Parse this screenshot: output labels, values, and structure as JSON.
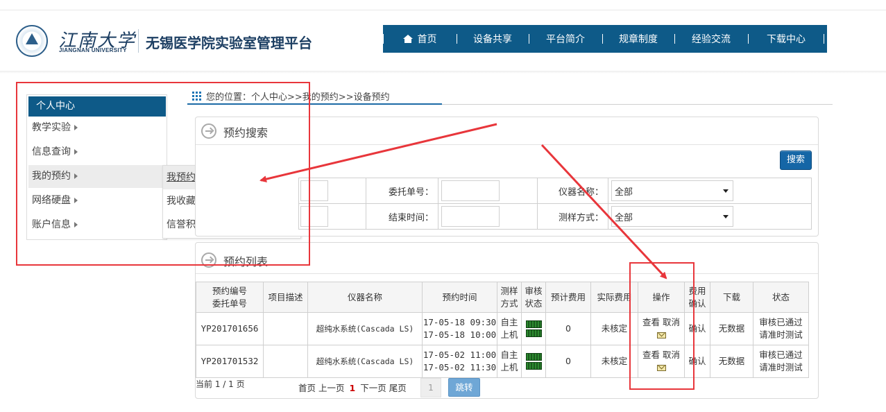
{
  "header": {
    "logo_cn": "江南大学",
    "logo_en": "JIANGNAN UNIVERSITY",
    "platform_title": "无锡医学院实验室管理平台",
    "nav": [
      {
        "label": "首页",
        "icon": "home-icon"
      },
      {
        "label": "设备共享"
      },
      {
        "label": "平台简介"
      },
      {
        "label": "规章制度"
      },
      {
        "label": "经验交流"
      },
      {
        "label": "下载中心"
      }
    ]
  },
  "sidebar": {
    "title": "个人中心",
    "items": [
      {
        "label": "教学实验"
      },
      {
        "label": "信息查询"
      },
      {
        "label": "我的预约"
      },
      {
        "label": "网络硬盘"
      },
      {
        "label": "账户信息"
      }
    ],
    "submenu": [
      {
        "label": "我预约的设备"
      },
      {
        "label": "我收藏的设备"
      },
      {
        "label": "信誉积分"
      }
    ]
  },
  "breadcrumb": "您的位置：个人中心>>我的预约>>设备预约",
  "search_panel": {
    "title": "预约搜索",
    "search_button": "搜索",
    "labels": {
      "delegation_no": "委托单号：",
      "instrument_name": "仪器名称：",
      "end_time": "结束时间：",
      "sample_method": "测样方式："
    },
    "instrument_select": "全部",
    "sample_select": "全部"
  },
  "list_panel": {
    "title": "预约列表",
    "columns": {
      "no_a": "预约编号",
      "no_b": "委托单号",
      "desc": "项目描述",
      "instrument": "仪器名称",
      "time": "预约时间",
      "method_a": "测样",
      "method_b": "方式",
      "audit_a": "审核",
      "audit_b": "状态",
      "est_fee": "预计费用",
      "actual_fee": "实际费用",
      "ops": "操作",
      "fee_confirm_a": "费用",
      "fee_confirm_b": "确认",
      "download": "下载",
      "status": "状态"
    },
    "rows": [
      {
        "no": "YP201701656",
        "desc": "",
        "instrument": "超纯水系统(Cascada LS)",
        "time_start": "17-05-18 09:30",
        "time_end": "17-05-18 10:00",
        "method_a": "自主",
        "method_b": "上机",
        "est_fee": "0",
        "actual_fee": "未核定",
        "view": "查看",
        "cancel": "取消",
        "confirm": "确认",
        "download": "无数据",
        "status_a": "审核已通过",
        "status_b": "请准时测试"
      },
      {
        "no": "YP201701532",
        "desc": "",
        "instrument": "超纯水系统(Cascada LS)",
        "time_start": "17-05-02 11:00",
        "time_end": "17-05-02 11:30",
        "method_a": "自主",
        "method_b": "上机",
        "est_fee": "0",
        "actual_fee": "未核定",
        "view": "查看",
        "cancel": "取消",
        "confirm": "确认",
        "download": "无数据",
        "status_a": "审核已通过",
        "status_b": "请准时测试"
      }
    ],
    "pager": {
      "summary": "当前 1 / 1 页",
      "first": "首页",
      "prev": "上一页",
      "current": "1",
      "next": "下一页",
      "last": "尾页",
      "page_input": "1",
      "jump": "跳转"
    }
  },
  "colors": {
    "nav_bg": "#0e5a88",
    "annotation_red": "#e8363b",
    "button_blue": "#1566a6"
  }
}
